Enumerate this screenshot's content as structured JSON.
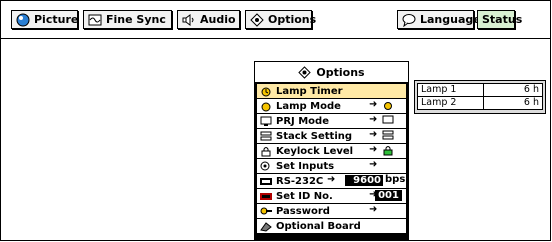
{
  "tabs": [
    {
      "label": "Picture",
      "icon": "picture-icon"
    },
    {
      "label": "Fine Sync",
      "icon": "fine-sync-icon"
    },
    {
      "label": "Audio",
      "icon": "speaker-icon"
    },
    {
      "label": "Options",
      "icon": "options-icon"
    },
    {
      "label": "Language",
      "icon": "language-icon"
    },
    {
      "label": "Status",
      "icon": ""
    }
  ],
  "panel": {
    "title": "Options",
    "items": [
      {
        "label": "Lamp Timer",
        "icon": "lamp-timer-icon"
      },
      {
        "label": "Lamp Mode",
        "icon": "lamp-mode-icon",
        "arrow": "➜"
      },
      {
        "label": "PRJ Mode",
        "icon": "prj-mode-icon",
        "arrow": "➜"
      },
      {
        "label": "Stack Setting",
        "icon": "stack-setting-icon",
        "arrow": "➜"
      },
      {
        "label": "Keylock Level",
        "icon": "keylock-icon",
        "arrow": "➜"
      },
      {
        "label": "Set Inputs",
        "icon": "set-inputs-icon",
        "arrow": "➜"
      },
      {
        "label": "RS-232C",
        "icon": "rs232c-icon",
        "arrow": "➜",
        "value": "9600",
        "unit": "bps"
      },
      {
        "label": "Set ID No.",
        "icon": "set-id-icon",
        "arrow": "➜",
        "value": "001"
      },
      {
        "label": "Password",
        "icon": "password-icon",
        "arrow": "➜"
      },
      {
        "label": "Optional Board",
        "icon": "optional-board-icon"
      }
    ]
  },
  "lamp_status": {
    "rows": [
      {
        "name": "Lamp 1",
        "value": "6 h"
      },
      {
        "name": "Lamp 2",
        "value": "6 h"
      }
    ]
  }
}
